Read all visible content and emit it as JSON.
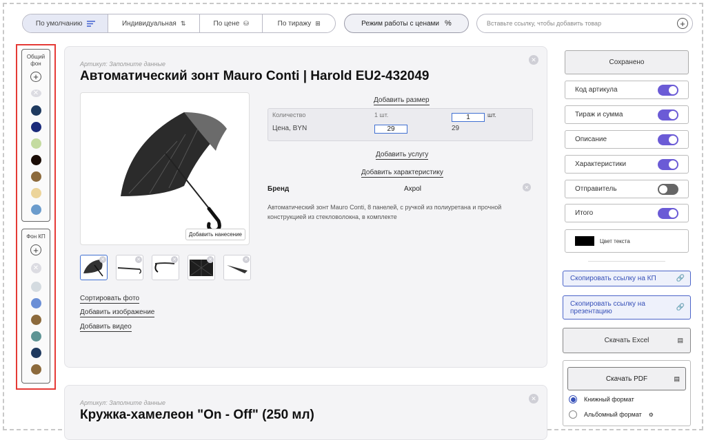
{
  "toolbar": {
    "sort_default": "По умолчанию",
    "sort_individual": "Индивидуальная",
    "sort_price": "По цене",
    "sort_run": "По тиражу",
    "price_mode": "Режим работы с ценами",
    "price_mode_symbol": "%",
    "url_placeholder": "Вставьте ссылку, чтобы добавить товар"
  },
  "bg_panel": {
    "title": "Общий фон",
    "swatches": [
      "#1f3a5f",
      "#1a2a7a",
      "#c4dba0",
      "#1a0d06",
      "#8c6a3c",
      "#ecd49a",
      "#6b9ccc"
    ]
  },
  "kp_panel": {
    "title": "Фон КП",
    "swatches": [
      "#d4dbe0",
      "#6b8fd6",
      "#8c6a3c",
      "#5e9494",
      "#1f3a5f",
      "#8c6a3c"
    ]
  },
  "product1": {
    "article_label": "Артикул:",
    "article_value": "Заполните данные",
    "title": "Автоматический зонт Mauro Conti | Harold EU2-432049",
    "add_size": "Добавить размер",
    "qty_label": "Количество",
    "qty_unit_text": "1 шт.",
    "qty_input": "1",
    "qty_unit": "шт.",
    "price_label": "Цена, BYN",
    "price_input": "29",
    "price_value": "29",
    "add_service": "Добавить услугу",
    "add_feature": "Добавить характеристику",
    "brand_label": "Бренд",
    "brand_value": "Axpol",
    "description": "Автоматический зонт Mauro Conti, 8 панелей, с ручкой из полиуретана и прочной конструкцией из стекловолокна, в комплекте",
    "add_print": "Добавить нанесение",
    "sort_photos": "Сортировать фото",
    "add_image": "Добавить изображение",
    "add_video": "Добавить видео"
  },
  "product2": {
    "article_label": "Артикул:",
    "article_value": "Заполните данные",
    "title": "Кружка-хамелеон \"On - Off\" (250 мл)"
  },
  "right": {
    "saved": "Сохранено",
    "toggles": [
      {
        "label": "Код артикула",
        "on": true
      },
      {
        "label": "Тираж и сумма",
        "on": true
      },
      {
        "label": "Описание",
        "on": true
      },
      {
        "label": "Характеристики",
        "on": true
      },
      {
        "label": "Отправитель",
        "on": false
      },
      {
        "label": "Итого",
        "on": true
      }
    ],
    "text_color_label": "Цвет текста",
    "text_color": "#000000",
    "copy_kp": "Скопировать ссылку на КП",
    "copy_presentation": "Скопировать ссылку на презентацию",
    "download_excel": "Скачать Excel",
    "download_pdf": "Скачать PDF",
    "format_portrait": "Книжный формат",
    "format_landscape": "Альбомный формат"
  },
  "colors": {
    "accent": "#6b5bd6",
    "link_blue": "#3650b8",
    "highlight": "#e53935"
  }
}
